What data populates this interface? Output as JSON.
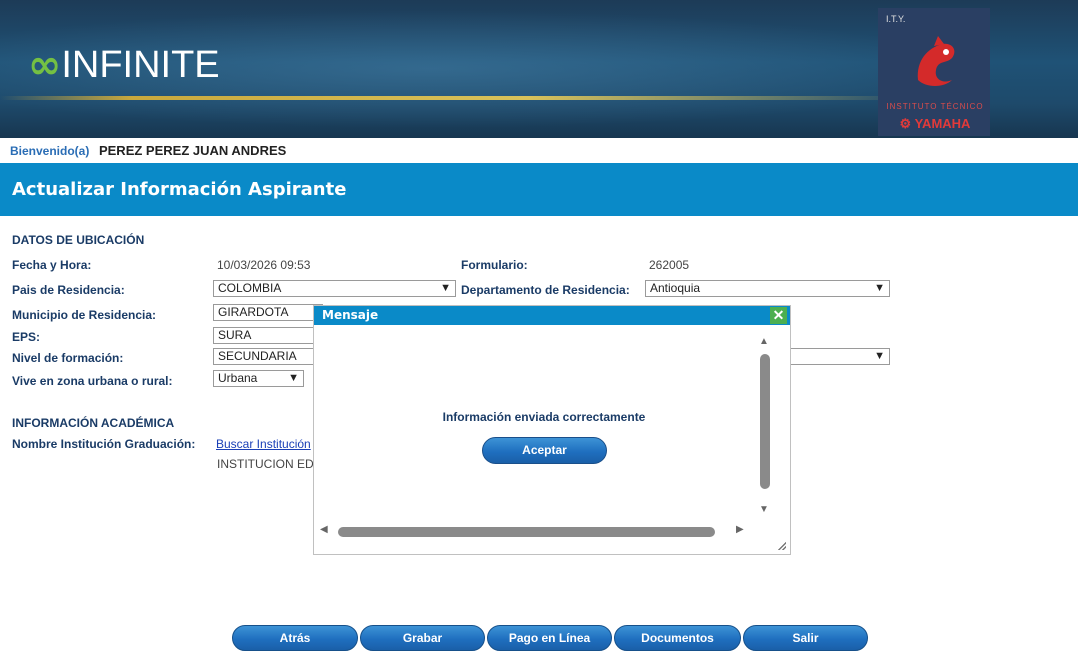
{
  "header": {
    "logo_word": "INFINITE",
    "ity_small": "I.T.Y.",
    "ity_institute": "INSTITUTO TÉCNICO",
    "ity_brand": "YAMAHA"
  },
  "welcome": {
    "label": "Bienvenido(a)",
    "user": "PEREZ PEREZ JUAN ANDRES"
  },
  "page_title": "Actualizar Información Aspirante",
  "ubicacion": {
    "section": "DATOS DE UBICACIÓN",
    "fecha_label": "Fecha y Hora:",
    "fecha_value": "10/03/2026 09:53",
    "formulario_label": "Formulario:",
    "formulario_value": "262005",
    "pais_label": "Pais de Residencia:",
    "pais_value": "COLOMBIA",
    "departamento_label": "Departamento de Residencia:",
    "departamento_value": "Antioquia",
    "municipio_label": "Municipio de Residencia:",
    "municipio_value": "GIRARDOTA",
    "eps_label": "EPS:",
    "eps_value": "SURA",
    "nivel_label": "Nivel de formación:",
    "nivel_value": "SECUNDARIA",
    "zona_label": "Vive en zona urbana o rural:",
    "zona_value": "Urbana"
  },
  "academica": {
    "section": "INFORMACIÓN ACADÉMICA",
    "institucion_label": "Nombre Institución Graduación:",
    "buscar_link": "Buscar Institución",
    "institucion_value": "INSTITUCION ED"
  },
  "modal": {
    "title": "Mensaje",
    "message": "Información enviada correctamente",
    "ok_label": "Aceptar"
  },
  "buttons": {
    "atras": "Atrás",
    "grabar": "Grabar",
    "pago": "Pago en Línea",
    "documentos": "Documentos",
    "salir": "Salir"
  },
  "colors": {
    "title_bar": "#0a8ac8",
    "button": "#1f6fbf",
    "label": "#1a3b66",
    "logo_green": "#74c043"
  }
}
